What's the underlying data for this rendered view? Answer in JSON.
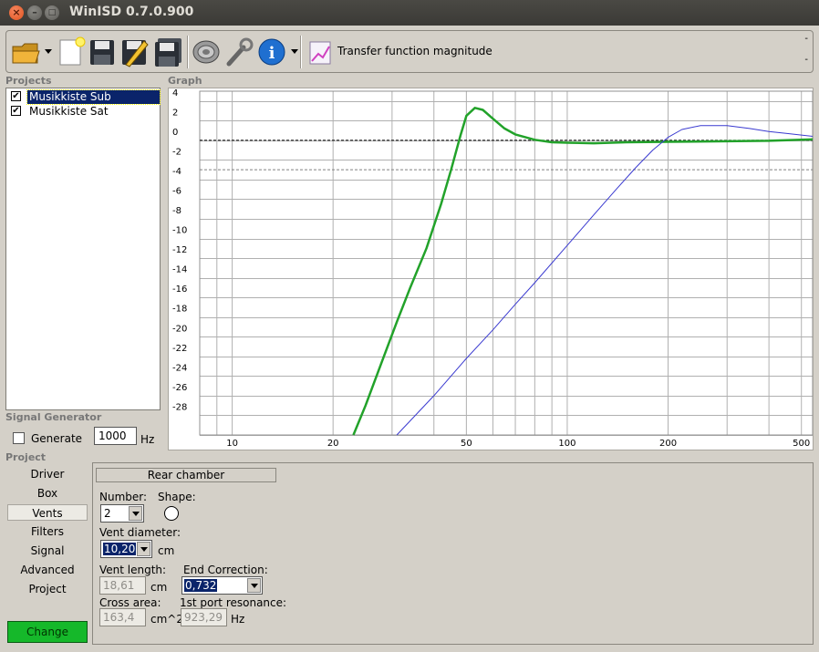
{
  "window": {
    "title": "WinISD 0.7.0.900"
  },
  "toolbar": {
    "graph_type_label": "Transfer function magnitude",
    "dash_top": "-",
    "dash_bottom": "-",
    "icons": [
      "open-folder-icon",
      "new-document-icon",
      "save-icon",
      "edit-icon",
      "save-all-icon",
      "driver-icon",
      "tools-icon",
      "info-icon",
      "graph-icon"
    ]
  },
  "sections": {
    "projects": "Projects",
    "graph": "Graph",
    "signal_generator": "Signal Generator",
    "project": "Project"
  },
  "projects": [
    {
      "name": "Musikkiste Sub",
      "checked": true,
      "selected": true
    },
    {
      "name": "Musikkiste Sat",
      "checked": true,
      "selected": false
    }
  ],
  "signal_generator": {
    "generate_label": "Generate",
    "generate_checked": false,
    "frequency": "1000",
    "unit": "Hz"
  },
  "nav": {
    "items": [
      "Driver",
      "Box",
      "Vents",
      "Filters",
      "Signal",
      "Advanced",
      "Project"
    ],
    "selected": "Vents",
    "change_label": "Change"
  },
  "vents": {
    "chamber": "Rear chamber",
    "number_label": "Number:",
    "number_value": "2",
    "shape_label": "Shape:",
    "vent_diameter_label": "Vent diameter:",
    "vent_diameter_value": "10,20",
    "vent_diameter_unit": "cm",
    "vent_length_label": "Vent length:",
    "vent_length_value": "18,61",
    "vent_length_unit": "cm",
    "end_correction_label": "End Correction:",
    "end_correction_value": "0,732",
    "cross_area_label": "Cross area:",
    "cross_area_value": "163,4",
    "cross_area_unit": "cm^2",
    "port_resonance_label": "1st port resonance:",
    "port_resonance_value": "923,29",
    "port_resonance_unit": "Hz"
  },
  "chart_data": {
    "type": "line",
    "title": "",
    "xlabel": "",
    "ylabel": "",
    "x_scale": "log",
    "xlim": [
      8,
      540
    ],
    "ylim": [
      -30,
      5
    ],
    "x_ticks": [
      10,
      20,
      50,
      100,
      200,
      500
    ],
    "y_ticks": [
      4,
      2,
      0,
      -2,
      -4,
      -6,
      -8,
      -10,
      -12,
      -14,
      -16,
      -18,
      -20,
      -22,
      -24,
      -26,
      -28
    ],
    "grid": true,
    "reference_lines": [
      {
        "y": 0,
        "style": "dashed",
        "color": "#000000"
      },
      {
        "y": -3,
        "style": "dashed",
        "color": "#808080"
      }
    ],
    "series": [
      {
        "color": "#22a22a",
        "x": [
          23,
          25,
          28,
          31,
          34,
          38,
          42,
          45,
          48,
          50,
          53,
          56,
          60,
          65,
          70,
          80,
          90,
          100,
          120,
          150,
          200,
          300,
          400,
          540
        ],
        "y": [
          -30,
          -27,
          -22.5,
          -18.5,
          -15,
          -11,
          -6.5,
          -3,
          0.5,
          2.5,
          3.3,
          3.1,
          2.2,
          1.2,
          0.6,
          0.05,
          -0.2,
          -0.25,
          -0.3,
          -0.2,
          -0.15,
          -0.1,
          -0.05,
          0.1
        ]
      },
      {
        "color": "#3a3ad0",
        "x": [
          31,
          40,
          50,
          60,
          70,
          80,
          100,
          120,
          140,
          160,
          180,
          200,
          220,
          250,
          300,
          350,
          400,
          450,
          540
        ],
        "y": [
          -30,
          -26,
          -22.2,
          -19.3,
          -16.7,
          -14.5,
          -10.7,
          -7.6,
          -5,
          -2.8,
          -1,
          0.3,
          1.1,
          1.5,
          1.5,
          1.2,
          0.9,
          0.7,
          0.4
        ]
      }
    ]
  }
}
